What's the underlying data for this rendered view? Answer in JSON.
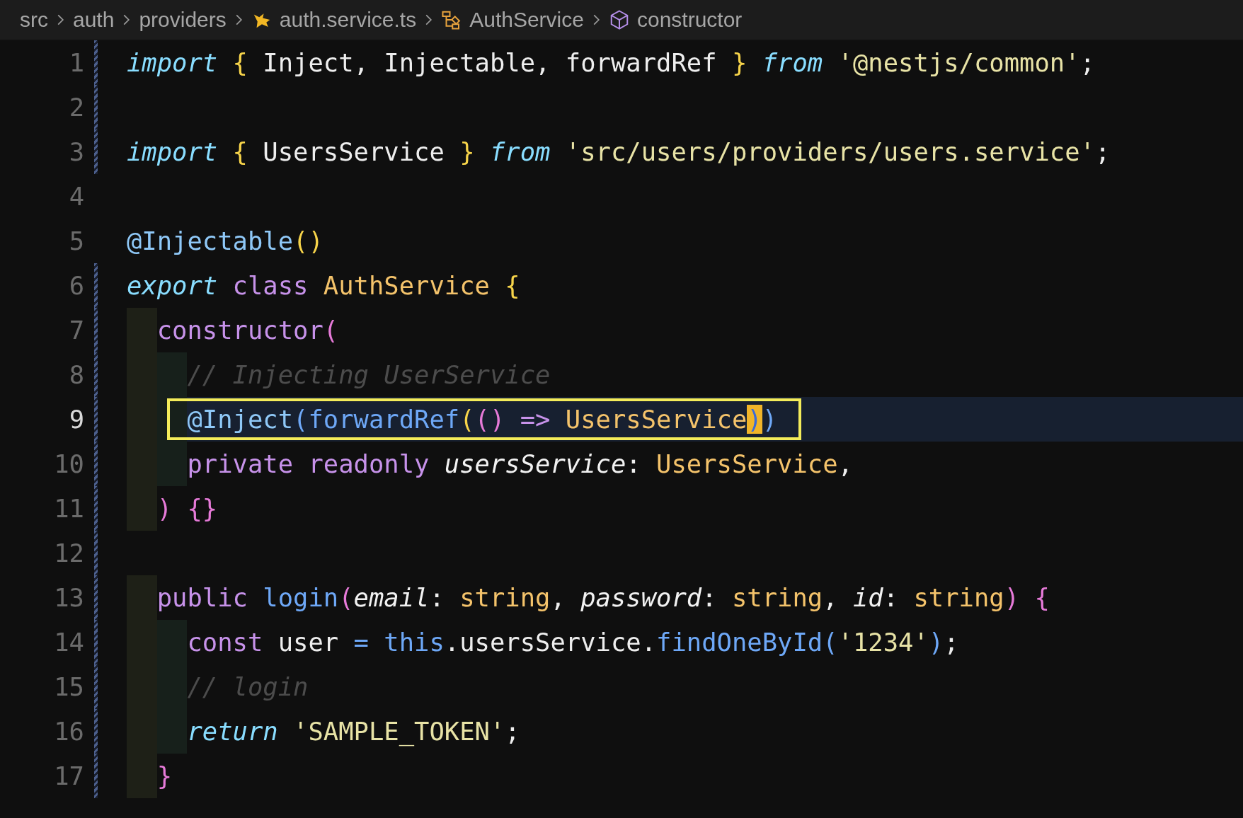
{
  "breadcrumb": [
    {
      "label": "src"
    },
    {
      "label": "auth"
    },
    {
      "label": "providers"
    },
    {
      "label": "auth.service.ts"
    },
    {
      "label": "AuthService"
    },
    {
      "label": "constructor"
    }
  ],
  "lines": [
    {
      "num": "1",
      "kind": "flat",
      "changed": true,
      "current": false,
      "boxed": false,
      "tokens": [
        {
          "text": "import",
          "kind": "kw"
        },
        {
          "text": " {",
          "kind": "brace"
        },
        {
          "text": " Inject, Injectable, forwardRef",
          "kind": "plain"
        },
        {
          "text": " }",
          "kind": "brace"
        },
        {
          "text": " from",
          "kind": "kw"
        },
        {
          "text": " '@nestjs/common'",
          "kind": "str"
        },
        {
          "text": ";",
          "kind": "plain"
        }
      ]
    },
    {
      "num": "2",
      "kind": "flat",
      "changed": true,
      "current": false,
      "boxed": false
    },
    {
      "num": "3",
      "kind": "flat",
      "changed": true,
      "current": false,
      "boxed": false,
      "tokens": [
        {
          "text": "import",
          "kind": "kw"
        },
        {
          "text": " {",
          "kind": "brace"
        },
        {
          "text": " UsersService",
          "kind": "plain"
        },
        {
          "text": " }",
          "kind": "brace"
        },
        {
          "text": " from",
          "kind": "kw"
        },
        {
          "text": " 'src/users/providers/users.service'",
          "kind": "str"
        },
        {
          "text": ";",
          "kind": "plain"
        }
      ]
    },
    {
      "num": "4",
      "kind": "flat",
      "changed": false,
      "current": false,
      "boxed": false
    },
    {
      "num": "5",
      "kind": "flat",
      "changed": false,
      "current": false,
      "boxed": false,
      "tokens": [
        {
          "text": "@Injectable",
          "kind": "deco"
        },
        {
          "text": "()",
          "kind": "brace"
        }
      ]
    },
    {
      "num": "6",
      "kind": "flat",
      "changed": true,
      "current": false,
      "boxed": false,
      "tokens": [
        {
          "text": "export",
          "kind": "kw"
        },
        {
          "text": " class",
          "kind": "store"
        },
        {
          "text": " AuthService",
          "kind": "type"
        },
        {
          "text": " {",
          "kind": "brace"
        }
      ]
    },
    {
      "num": "7",
      "kind": "indent1",
      "changed": true,
      "current": false,
      "boxed": false,
      "tokens": [
        {
          "text": "constructor",
          "kind": "store"
        },
        {
          "text": "(",
          "kind": "paren"
        }
      ]
    },
    {
      "num": "8",
      "kind": "indent2",
      "changed": true,
      "current": false,
      "boxed": false,
      "tokens": [
        {
          "text": "// Injecting UserService",
          "kind": "comment"
        }
      ]
    },
    {
      "num": "9",
      "kind": "indent2",
      "changed": true,
      "current": true,
      "boxed": true,
      "tokens": [
        {
          "text": "@Inject",
          "kind": "deco"
        },
        {
          "text": "(",
          "kind": "fn"
        },
        {
          "text": "forwardRef",
          "kind": "fn"
        },
        {
          "text": "(",
          "kind": "brace"
        },
        {
          "text": "()",
          "kind": "paren"
        },
        {
          "text": " =>",
          "kind": "store"
        },
        {
          "text": " UsersService",
          "kind": "type"
        },
        {
          "text": ")",
          "kind": "cursor"
        },
        {
          "text": ")",
          "kind": "fn"
        }
      ]
    },
    {
      "num": "10",
      "kind": "indent2",
      "changed": true,
      "current": false,
      "boxed": false,
      "tokens": [
        {
          "text": "private",
          "kind": "store"
        },
        {
          "text": " readonly",
          "kind": "store"
        },
        {
          "text": " usersService",
          "kind": "param"
        },
        {
          "text": ":",
          "kind": "plain"
        },
        {
          "text": " UsersService",
          "kind": "type"
        },
        {
          "text": ",",
          "kind": "plain"
        }
      ]
    },
    {
      "num": "11",
      "kind": "indent1",
      "changed": true,
      "current": false,
      "boxed": false,
      "tokens": [
        {
          "text": ")",
          "kind": "paren"
        },
        {
          "text": " {}",
          "kind": "paren"
        }
      ]
    },
    {
      "num": "12",
      "kind": "flat",
      "changed": true,
      "current": false,
      "boxed": false
    },
    {
      "num": "13",
      "kind": "indent1",
      "changed": true,
      "current": false,
      "boxed": false,
      "tokens": [
        {
          "text": "public",
          "kind": "store"
        },
        {
          "text": " login",
          "kind": "fn"
        },
        {
          "text": "(",
          "kind": "paren"
        },
        {
          "text": "email",
          "kind": "param"
        },
        {
          "text": ":",
          "kind": "plain"
        },
        {
          "text": " string",
          "kind": "type"
        },
        {
          "text": ",",
          "kind": "plain"
        },
        {
          "text": " password",
          "kind": "param"
        },
        {
          "text": ":",
          "kind": "plain"
        },
        {
          "text": " string",
          "kind": "type"
        },
        {
          "text": ",",
          "kind": "plain"
        },
        {
          "text": " id",
          "kind": "param"
        },
        {
          "text": ":",
          "kind": "plain"
        },
        {
          "text": " string",
          "kind": "type"
        },
        {
          "text": ")",
          "kind": "paren"
        },
        {
          "text": " {",
          "kind": "paren"
        }
      ]
    },
    {
      "num": "14",
      "kind": "indent2",
      "changed": true,
      "current": false,
      "boxed": false,
      "tokens": [
        {
          "text": "const",
          "kind": "store"
        },
        {
          "text": " user",
          "kind": "plain"
        },
        {
          "text": " =",
          "kind": "fn"
        },
        {
          "text": " this",
          "kind": "fn"
        },
        {
          "text": ".usersService.",
          "kind": "plain"
        },
        {
          "text": "findOneById",
          "kind": "fn"
        },
        {
          "text": "(",
          "kind": "fn"
        },
        {
          "text": "'1234'",
          "kind": "str"
        },
        {
          "text": ")",
          "kind": "fn"
        },
        {
          "text": ";",
          "kind": "plain"
        }
      ]
    },
    {
      "num": "15",
      "kind": "indent2",
      "changed": true,
      "current": false,
      "boxed": false,
      "tokens": [
        {
          "text": "// login",
          "kind": "comment"
        }
      ]
    },
    {
      "num": "16",
      "kind": "indent2",
      "changed": true,
      "current": false,
      "boxed": false,
      "tokens": [
        {
          "text": "return",
          "kind": "kw"
        },
        {
          "text": " 'SAMPLE_TOKEN'",
          "kind": "str"
        },
        {
          "text": ";",
          "kind": "plain"
        }
      ]
    },
    {
      "num": "17",
      "kind": "indent1",
      "changed": true,
      "current": false,
      "boxed": false,
      "tokens": [
        {
          "text": "}",
          "kind": "paren"
        }
      ]
    }
  ]
}
